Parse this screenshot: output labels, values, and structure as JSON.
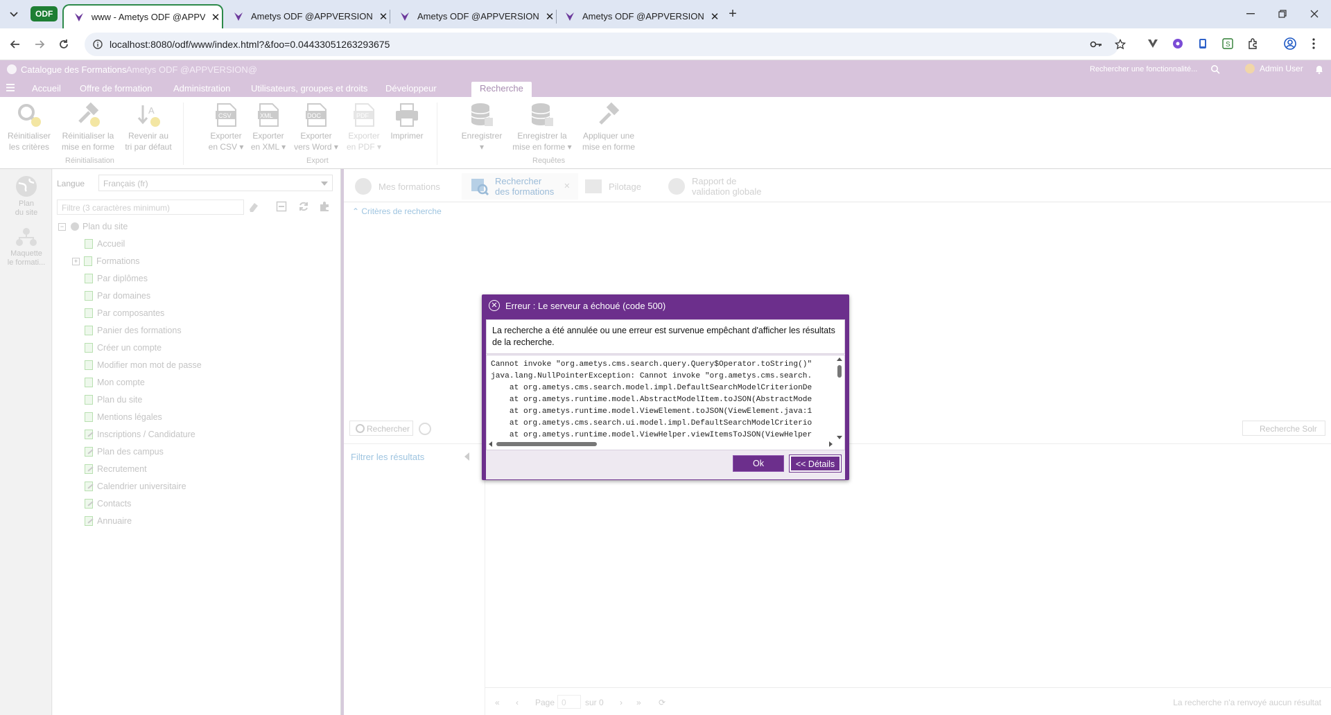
{
  "browser": {
    "profile_badge": "ODF",
    "tabs": [
      {
        "title": "www - Ametys ODF @APPVERSI",
        "active": true
      },
      {
        "title": "Ametys ODF @APPVERSION@"
      },
      {
        "title": "Ametys ODF @APPVERSION@"
      },
      {
        "title": "Ametys ODF @APPVERSION@"
      }
    ],
    "url": "localhost:8080/odf/www/index.html?&foo=0.04433051263293675"
  },
  "app": {
    "title": "Catalogue des Formations",
    "version": "Ametys ODF @APPVERSION@",
    "search_placeholder": "Rechercher une fonctionnalité...",
    "user": "Admin User",
    "menu_tabs": [
      "Accueil",
      "Offre de formation",
      "Administration",
      "Utilisateurs, groupes et droits",
      "Développeur",
      "Recherche"
    ]
  },
  "ribbon": {
    "buttons": [
      {
        "line1": "Réinitialiser",
        "line2": "les critères"
      },
      {
        "line1": "Réinitialiser la",
        "line2": "mise en forme"
      },
      {
        "line1": "Revenir au",
        "line2": "tri par défaut"
      },
      {
        "line1": "Exporter",
        "line2": "en CSV ▾"
      },
      {
        "line1": "Exporter",
        "line2": "en XML ▾"
      },
      {
        "line1": "Exporter",
        "line2": "vers Word ▾"
      },
      {
        "line1": "Exporter",
        "line2": "en PDF ▾"
      },
      {
        "line1": "Imprimer",
        "line2": ""
      },
      {
        "line1": "Enregistrer",
        "line2": "▾"
      },
      {
        "line1": "Enregistrer la",
        "line2": "mise en forme ▾"
      },
      {
        "line1": "Appliquer une",
        "line2": "mise en forme"
      }
    ],
    "icon_labels": {
      "csv": "CSV",
      "xml": "XML",
      "doc": "DOC",
      "pdf": "PDF"
    },
    "groups": [
      "Réinitialisation",
      "Export",
      "Requêtes"
    ]
  },
  "dock": {
    "items": [
      {
        "line1": "Plan",
        "line2": "du site"
      },
      {
        "line1": "Maquette",
        "line2": "le formati..."
      }
    ]
  },
  "sitemap": {
    "lang_label": "Langue",
    "lang_value": "Français (fr)",
    "filter_placeholder": "Filtre (3 caractères minimum)",
    "nodes": [
      "Plan du site",
      "Accueil",
      "Formations",
      "Par diplômes",
      "Par domaines",
      "Par composantes",
      "Panier des formations",
      "Créer un compte",
      "Modifier mon mot de passe",
      "Mon compte",
      "Plan du site",
      "Mentions légales",
      "Inscriptions / Candidature",
      "Plan des campus",
      "Recrutement",
      "Calendrier universitaire",
      "Contacts",
      "Annuaire"
    ]
  },
  "tools": {
    "tabs": [
      {
        "line1": "Mes formations",
        "line2": ""
      },
      {
        "line1": "Rechercher",
        "line2": "des formations"
      },
      {
        "line1": "Pilotage",
        "line2": ""
      },
      {
        "line1": "Rapport de",
        "line2": "validation globale"
      }
    ],
    "criteria": "Critères de recherche",
    "search_btn": "Rechercher",
    "solr_btn": "Recherche Solr",
    "filter_results": "Filtrer les résultats",
    "pager": {
      "page": "Page",
      "value": "0",
      "of": "sur 0",
      "status": "La recherche n'a renvoyé aucun résultat"
    }
  },
  "dialog": {
    "title": "Erreur : Le serveur a échoué (code 500)",
    "message": "La recherche a été annulée ou une erreur est survenue empêchant d'afficher les résultats de la recherche.",
    "trace": "Cannot invoke \"org.ametys.cms.search.query.Query$Operator.toString()\"\njava.lang.NullPointerException: Cannot invoke \"org.ametys.cms.search.\n    at org.ametys.cms.search.model.impl.DefaultSearchModelCriterionDe\n    at org.ametys.runtime.model.AbstractModelItem.toJSON(AbstractMode\n    at org.ametys.runtime.model.ViewElement.toJSON(ViewElement.java:1\n    at org.ametys.cms.search.ui.model.impl.DefaultSearchModelCriterio\n    at org.ametys.runtime.model.ViewHelper.viewItemsToJSON(ViewHelper",
    "ok": "Ok",
    "details": "<< Détails"
  }
}
